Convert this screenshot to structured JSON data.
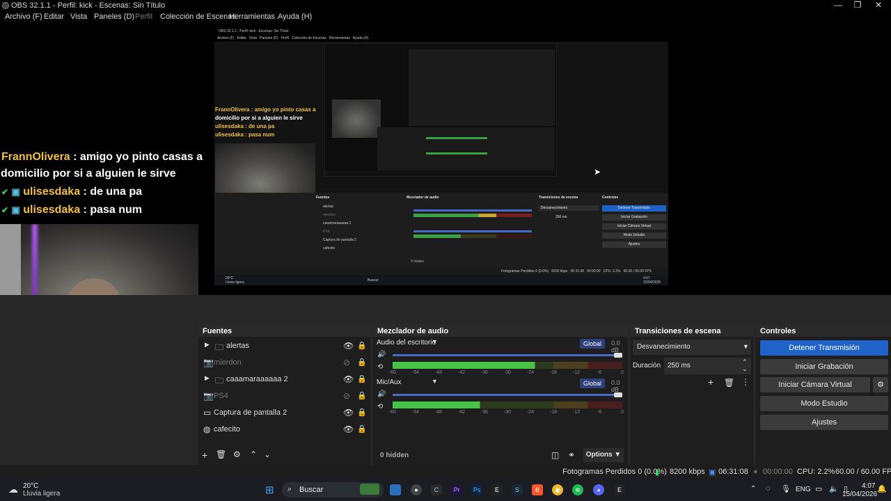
{
  "window": {
    "title": "OBS 32.1.1 - Perfil: kick - Escenas: Sin Título",
    "minimize": "—",
    "maximize": "❐",
    "close": "✕"
  },
  "menu": [
    "Archivo (F)",
    "Editar",
    "Vista",
    "Paneles (D)",
    "Perfil",
    "Colección de Escenas",
    "Herramientas",
    "Ayuda (H)"
  ],
  "chat": {
    "line1_name": "FrannOlivera",
    "line1_text": " : amigo yo pinto casas a",
    "line1b_text": "domicilio por si a alguien le sirve",
    "line2_name": "ulisesdaka",
    "line2_text": " : de una pa",
    "line3_name": "ulisesdaka",
    "line3_text": " : pasa num"
  },
  "sources": {
    "title": "Fuentes",
    "items": [
      {
        "label": "alertas",
        "icon": "folder-icon",
        "dim": false,
        "expand": true
      },
      {
        "label": "mierdon",
        "icon": "camera-icon",
        "dim": true,
        "expand": false
      },
      {
        "label": "caaamaraaaaaa 2",
        "icon": "folder-icon",
        "dim": false,
        "expand": true
      },
      {
        "label": "PS4",
        "icon": "camera-icon",
        "dim": true,
        "expand": false
      },
      {
        "label": "Captura de pantalla 2",
        "icon": "monitor-icon",
        "dim": false,
        "expand": false
      },
      {
        "label": "cafecito",
        "icon": "globe-icon",
        "dim": false,
        "expand": false
      }
    ]
  },
  "mixer": {
    "title": "Mezclador de audio",
    "channels": [
      {
        "name": "Audio del escritorio",
        "badge": "Global",
        "db": "0.0 dB",
        "level": 0.62
      },
      {
        "name": "Mic/Aux",
        "badge": "Global",
        "db": "0.0 dB",
        "level": 0.38
      }
    ],
    "ticks": [
      "-60",
      "-54",
      "-48",
      "-42",
      "-36",
      "-30",
      "-24",
      "-18",
      "-12",
      "-6",
      "0"
    ],
    "hidden": "0 hidden",
    "options": "Options"
  },
  "transitions": {
    "title": "Transiciones de escena",
    "selected": "Desvanecimiento",
    "duration_label": "Duración",
    "duration_value": "250 ms"
  },
  "controls": {
    "title": "Controles",
    "buttons": [
      "Detener Transmisión",
      "Iniciar Grabación",
      "Iniciar Cámara Virtual",
      "Modo Estudio",
      "Ajustes"
    ]
  },
  "status": {
    "dropped": "Fotogramas Perdidos 0 (0.0%)",
    "bitrate": "8200 kbps",
    "stream_time": "06:31:08",
    "rec_time": "00:00:00",
    "cpu": "CPU: 2.2%",
    "fps": "60.00 / 60.00 FPS"
  },
  "taskbar": {
    "weather_temp": "20°C",
    "weather_desc": "Lluvia ligera",
    "search": "Buscar",
    "lang": "ENG",
    "time": "4:07",
    "date": "15/04/2026"
  },
  "nested": {
    "title": "OBS 32.1.1 - Perfil: kick - Escenas: Sin Título",
    "menu": "Archivo (F)   Editar   Vista   Paneles (D)   Perfil   Colección de Escenas   Herramientas   Ayuda (H)",
    "chat1": "FrannOlivera : amigo yo pinto casas a",
    "chat1b": "domicilio por si a alguien le sirve",
    "chat2": "ulisesdaka : de una pa",
    "chat3": "ulisesdaka : pasa num",
    "docks": [
      "Fuentes",
      "Mezclador de audio",
      "Transiciones de escena",
      "Controles"
    ],
    "sources": [
      "alertas",
      "mierdon",
      "caaamaraaaaaa 2",
      "PS4",
      "Captura de pantalla 2",
      "cafecito"
    ],
    "ctl": [
      "Detener Transmisión",
      "Iniciar Grabación",
      "Iniciar Cámara Virtual",
      "Modo Estudio",
      "Ajustes"
    ],
    "trans": "Desvanecimiento",
    "dur": "250 ms",
    "hidden": "0 hidden",
    "status": "Fotogramas Perdidos 0 (0.0%)   8200 kbps   06:31:08   00:00:00   CPU: 2.2%   60.00 / 60.00 FPS",
    "search": "Buscar",
    "temp": "20°C",
    "desc": "Lluvia ligera",
    "time": "4:07",
    "date": "15/04/2026"
  }
}
